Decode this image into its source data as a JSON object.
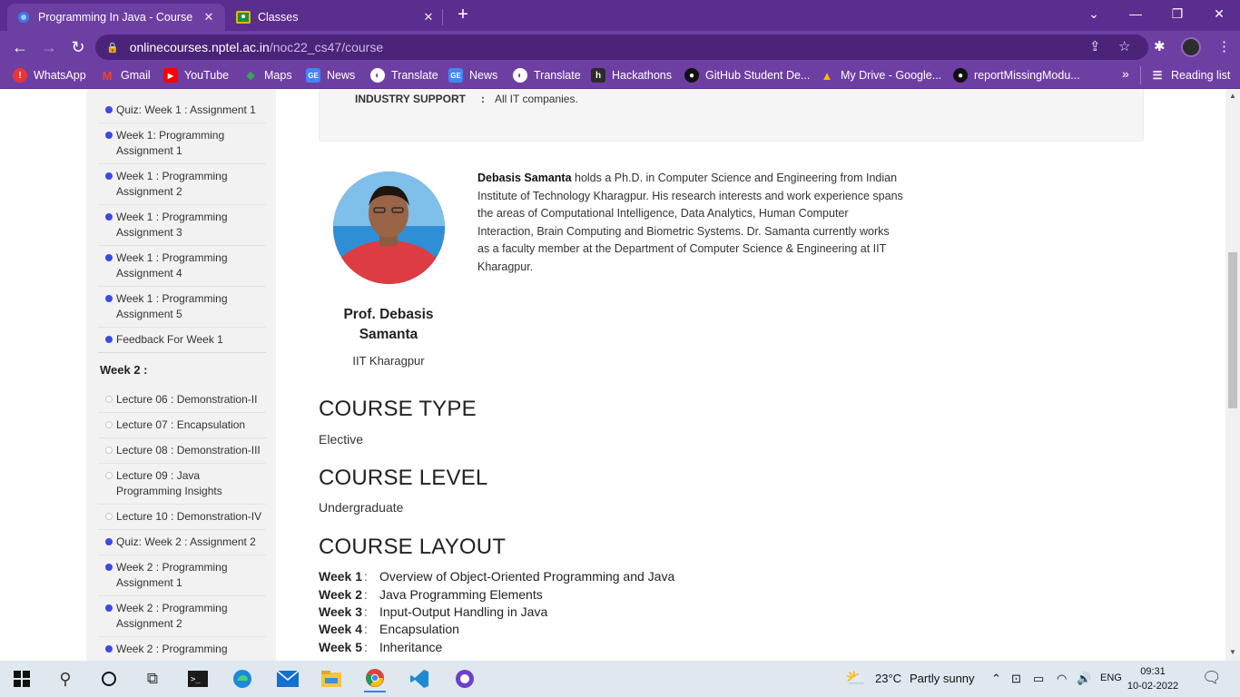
{
  "browser": {
    "tabs": [
      {
        "title": "Programming In Java - Course",
        "active": true
      },
      {
        "title": "Classes",
        "active": false
      }
    ],
    "url_host": "onlinecourses.nptel.ac.in",
    "url_path": "/noc22_cs47/course",
    "bookmarks": [
      {
        "label": "WhatsApp",
        "icon": "whatsapp-icon"
      },
      {
        "label": "Gmail",
        "icon": "gmail-icon"
      },
      {
        "label": "YouTube",
        "icon": "youtube-icon"
      },
      {
        "label": "Maps",
        "icon": "maps-icon"
      },
      {
        "label": "News",
        "icon": "google-news-icon"
      },
      {
        "label": "Translate",
        "icon": "translate-icon"
      },
      {
        "label": "News",
        "icon": "google-news-icon"
      },
      {
        "label": "Translate",
        "icon": "translate-icon"
      },
      {
        "label": "Hackathons",
        "icon": "hackathons-icon"
      },
      {
        "label": "GitHub Student De...",
        "icon": "github-icon"
      },
      {
        "label": "My Drive - Google...",
        "icon": "google-drive-icon"
      },
      {
        "label": "reportMissingModu...",
        "icon": "github-icon"
      }
    ],
    "more_bookmarks": "»",
    "reading_list": "Reading list"
  },
  "sidebar": {
    "week1_items": [
      {
        "label": "Quiz: Week 1 : Assignment 1",
        "filled": true
      },
      {
        "label": "Week 1: Programming Assignment 1",
        "filled": true
      },
      {
        "label": "Week 1 : Programming Assignment 2",
        "filled": true
      },
      {
        "label": "Week 1 : Programming Assignment 3",
        "filled": true
      },
      {
        "label": "Week 1 : Programming Assignment 4",
        "filled": true
      },
      {
        "label": "Week 1 : Programming Assignment 5",
        "filled": true
      },
      {
        "label": "Feedback For Week 1",
        "filled": true
      }
    ],
    "week2_heading": "Week 2 :",
    "week2_items": [
      {
        "label": "Lecture 06 : Demonstration-II",
        "filled": false
      },
      {
        "label": "Lecture 07 : Encapsulation",
        "filled": false
      },
      {
        "label": "Lecture 08 : Demonstration-III",
        "filled": false
      },
      {
        "label": "Lecture 09 : Java Programming Insights",
        "filled": false
      },
      {
        "label": "Lecture 10 : Demonstration-IV",
        "filled": false
      },
      {
        "label": "Quiz: Week 2 : Assignment 2",
        "filled": true
      },
      {
        "label": "Week 2 : Programming Assignment 1",
        "filled": true
      },
      {
        "label": "Week 2 : Programming Assignment 2",
        "filled": true
      },
      {
        "label": "Week 2 : Programming",
        "filled": true
      }
    ]
  },
  "course": {
    "industry_support_label": "INDUSTRY SUPPORT",
    "industry_support_colon": ":",
    "industry_support_value": "All IT companies.",
    "instructor": {
      "name": "Prof. Debasis Samanta",
      "institute": "IIT Kharagpur",
      "bio_name": "Debasis Samanta",
      "bio_text": " holds a Ph.D. in Computer Science and Engineering from Indian Institute of Technology Kharagpur. His research interests and work experience spans the areas of Computational Intelligence, Data Analytics, Human Computer Interaction, Brain Computing and Biometric Systems. Dr. Samanta currently works as a faculty member at the Department of Computer Science & Engineering at IIT Kharagpur."
    },
    "course_type_heading": "COURSE TYPE",
    "course_type": "Elective",
    "course_level_heading": "COURSE LEVEL",
    "course_level": "Undergraduate",
    "course_layout_heading": "COURSE LAYOUT",
    "layout": [
      {
        "week": "Week 1",
        "topic": "Overview of Object-Oriented Programming and Java"
      },
      {
        "week": "Week 2",
        "topic": "Java Programming Elements"
      },
      {
        "week": "Week 3",
        "topic": "Input-Output Handling in Java"
      },
      {
        "week": "Week 4",
        "topic": "Encapsulation"
      },
      {
        "week": "Week 5",
        "topic": "Inheritance"
      }
    ]
  },
  "taskbar": {
    "weather_temp": "23°C",
    "weather_desc": "Partly sunny",
    "language": "ENG",
    "time": "09:31",
    "date": "10-02-2022"
  }
}
